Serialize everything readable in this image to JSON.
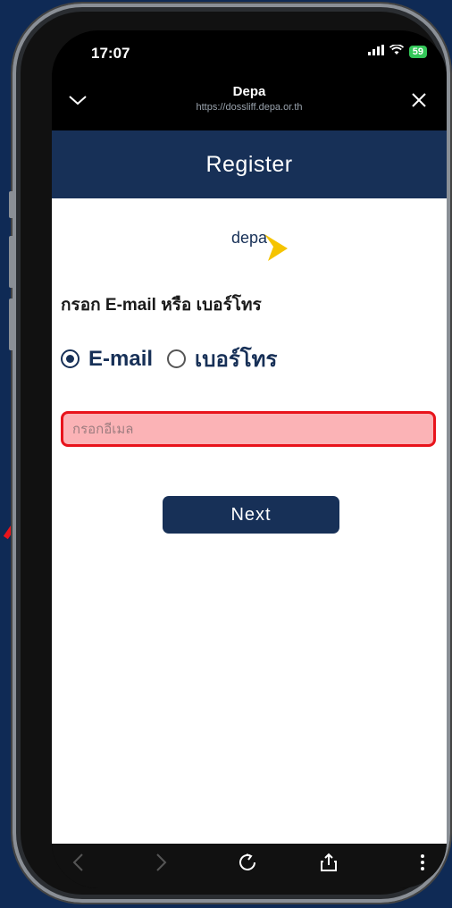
{
  "status_bar": {
    "time": "17:07",
    "battery": "59",
    "signal_icon": "signal-icon",
    "wifi_icon": "wifi-icon"
  },
  "browser_bar": {
    "title": "Depa",
    "url": "https://dossliff.depa.or.th",
    "collapse_icon": "chevron-down-icon",
    "close_icon": "close-icon"
  },
  "page": {
    "header_title": "Register",
    "logo_text": "depa",
    "prompt": "กรอก E-mail หรือ เบอร์โทร",
    "options": [
      {
        "label": "E-mail",
        "selected": true
      },
      {
        "label": "เบอร์โทร",
        "selected": false
      }
    ],
    "email_input": {
      "placeholder": "กรอกอีเมล",
      "value": ""
    },
    "next_label": "Next"
  },
  "toolbar": {
    "icons": [
      "back-icon",
      "forward-icon",
      "reload-icon",
      "share-icon",
      "more-icon"
    ]
  },
  "colors": {
    "brand_navy": "#173057",
    "highlight_red": "#e8141c",
    "highlight_fill": "#fbb3b6",
    "background": "#0f2a55",
    "logo_yellow": "#f5c400"
  }
}
